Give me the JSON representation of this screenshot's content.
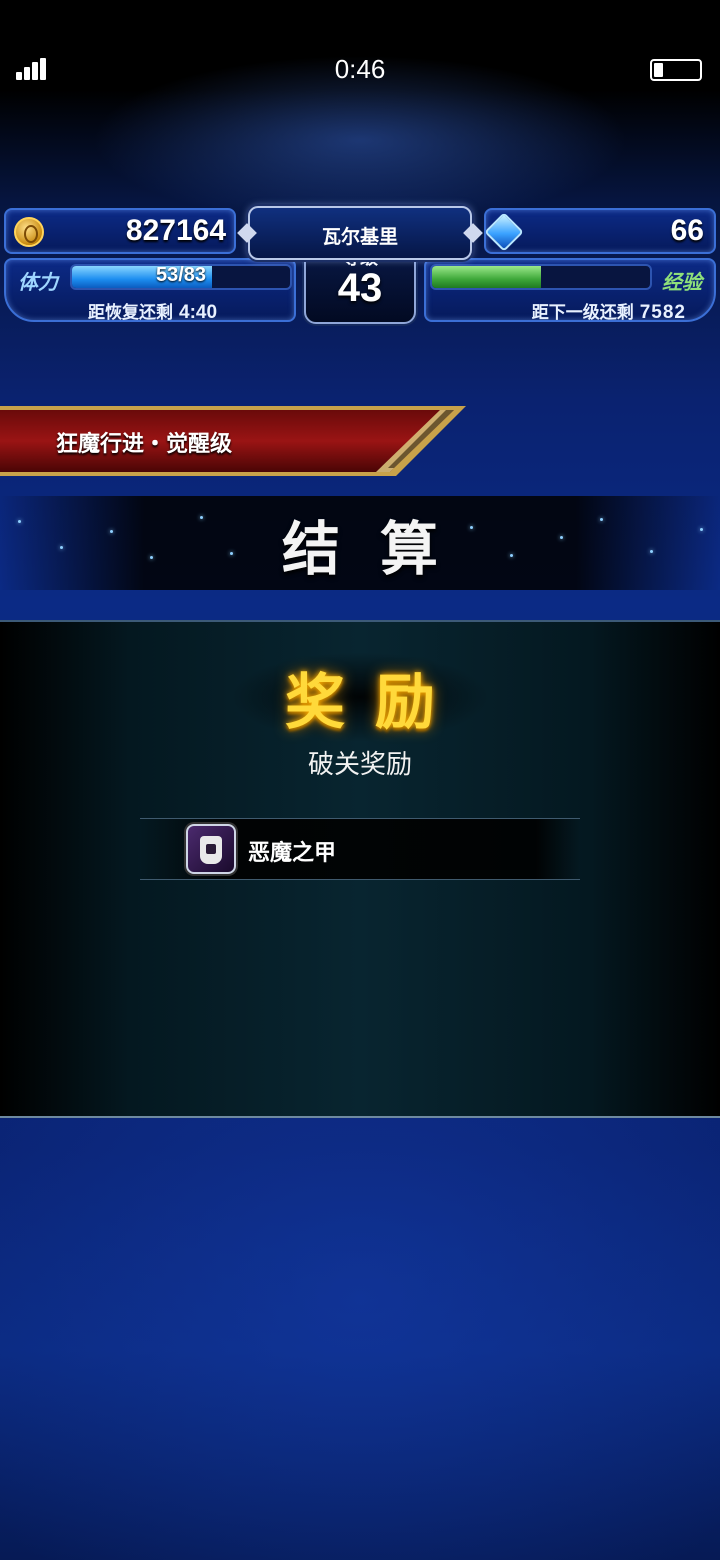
{
  "status_bar": {
    "time": "0:46"
  },
  "hud": {
    "gold": "827164",
    "gems": "66",
    "player_name": "瓦尔基里",
    "level_label": "等级",
    "level": "43",
    "stamina_label": "体力",
    "stamina_text": "53/83",
    "stamina_fraction": 0.64,
    "recover_label": "距恢复还剩",
    "recover_time": "4:40",
    "exp_label": "经验",
    "exp_fraction": 0.5,
    "next_label": "距下一级还剩",
    "next_exp": "7582"
  },
  "stage": {
    "name": "狂魔行进・觉醒级"
  },
  "settlement": {
    "title": "结算"
  },
  "reward": {
    "title": "奖励",
    "subtitle": "破关奖励",
    "items": [
      {
        "name": "恶魔之甲",
        "icon": "demon-armor-icon"
      }
    ]
  }
}
